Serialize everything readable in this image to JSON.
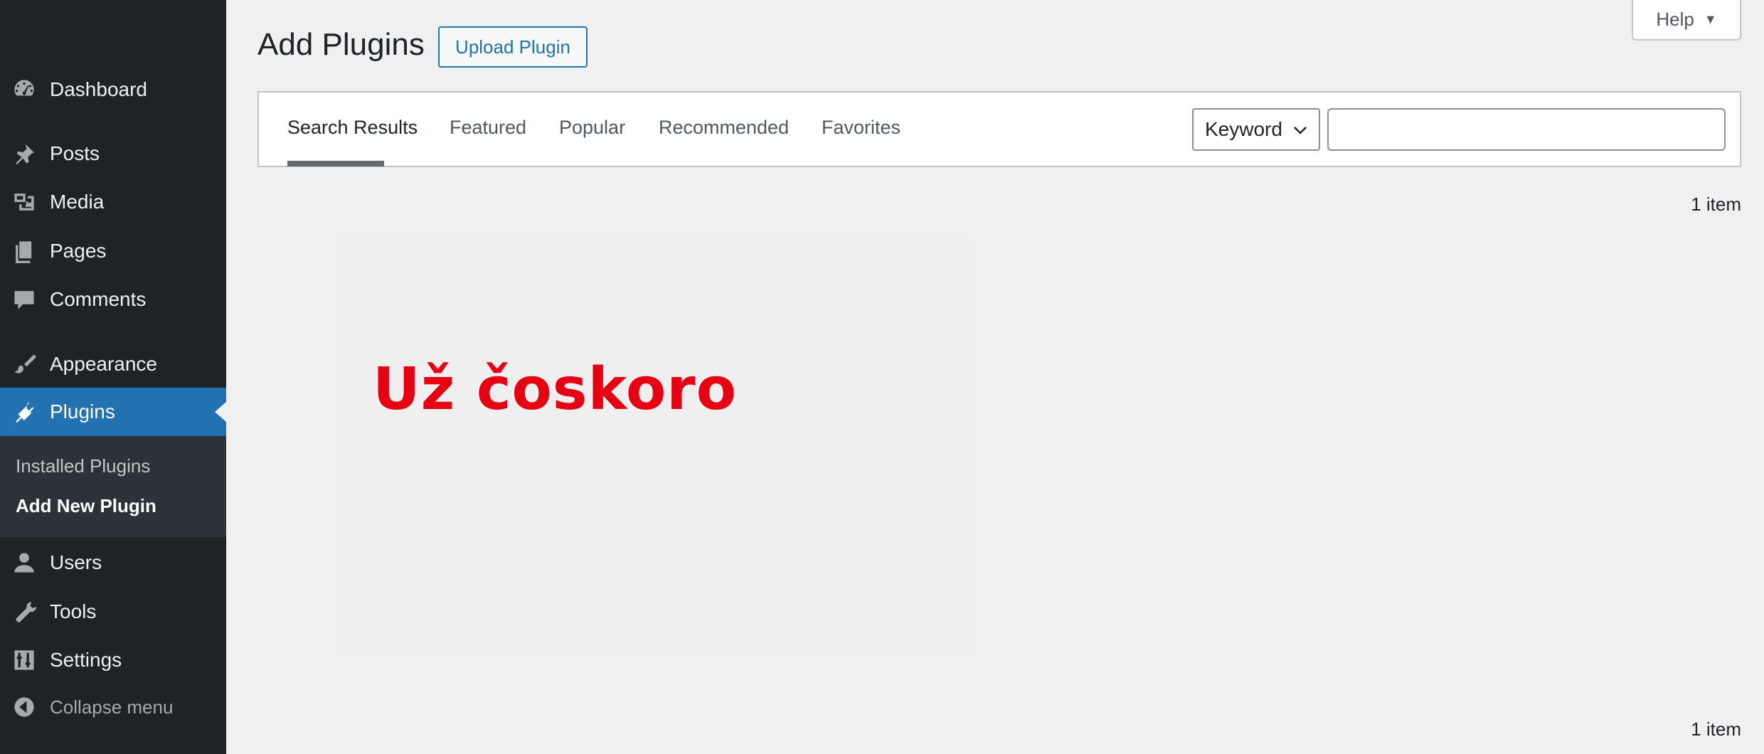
{
  "sidebar": {
    "items": [
      {
        "label": "Dashboard",
        "icon": "dashboard-icon"
      },
      {
        "label": "Posts",
        "icon": "pushpin-icon"
      },
      {
        "label": "Media",
        "icon": "media-icon"
      },
      {
        "label": "Pages",
        "icon": "pages-icon"
      },
      {
        "label": "Comments",
        "icon": "comment-icon"
      },
      {
        "label": "Appearance",
        "icon": "paintbrush-icon"
      },
      {
        "label": "Plugins",
        "icon": "plugin-icon",
        "active": true
      },
      {
        "label": "Users",
        "icon": "user-icon"
      },
      {
        "label": "Tools",
        "icon": "wrench-icon"
      },
      {
        "label": "Settings",
        "icon": "settings-sliders-icon"
      }
    ],
    "submenu": [
      {
        "label": "Installed Plugins"
      },
      {
        "label": "Add New Plugin",
        "current": true
      }
    ],
    "collapse_label": "Collapse menu"
  },
  "header": {
    "title": "Add Plugins",
    "upload_label": "Upload Plugin",
    "help_label": "Help"
  },
  "filter": {
    "tabs": [
      {
        "label": "Search Results",
        "current": true
      },
      {
        "label": "Featured"
      },
      {
        "label": "Popular"
      },
      {
        "label": "Recommended"
      },
      {
        "label": "Favorites"
      }
    ],
    "select_value": "Keyword",
    "search_value": ""
  },
  "results": {
    "count_top": "1 item",
    "count_bottom": "1 item"
  },
  "main": {
    "overlay_text": "Už čoskoro"
  },
  "colors": {
    "sidebar_bg": "#1d2327",
    "active_item": "#2271b1",
    "overlay_text": "#e60012"
  }
}
